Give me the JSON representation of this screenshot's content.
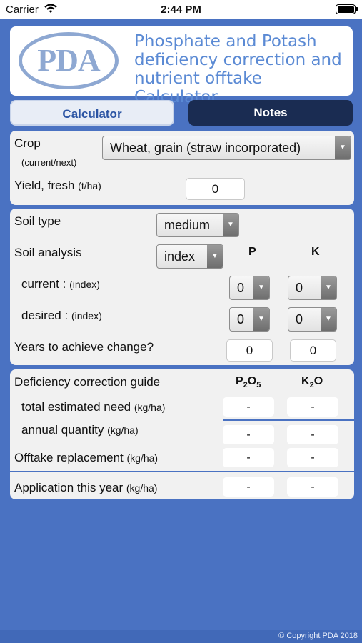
{
  "status_bar": {
    "carrier": "Carrier",
    "time": "2:44 PM"
  },
  "header": {
    "logo_text": "PDA",
    "title": "Phosphate and Potash deficiency correction and nutrient offtake Calculator"
  },
  "tabs": {
    "calculator": "Calculator",
    "notes": "Notes"
  },
  "crop": {
    "label": "Crop",
    "sublabel": "(current/next)",
    "value": "Wheat, grain (straw incorporated)"
  },
  "yield": {
    "label": "Yield, fresh",
    "unit": "(t/ha)",
    "value": "0"
  },
  "soil": {
    "type_label": "Soil type",
    "type_value": "medium",
    "analysis_label": "Soil analysis",
    "analysis_value": "index",
    "col_p": "P",
    "col_k": "K",
    "current_label": "current :",
    "current_unit": "(index)",
    "current_p": "0",
    "current_k": "0",
    "desired_label": "desired :",
    "desired_unit": "(index)",
    "desired_p": "0",
    "desired_k": "0",
    "years_label": "Years to achieve change?",
    "years_p": "0",
    "years_k": "0"
  },
  "results": {
    "guide_label": "Deficiency correction guide",
    "col_p2o5": "P2O5",
    "col_k2o": "K2O",
    "total_label": "total estimated need",
    "total_unit": "(kg/ha)",
    "total_p": "-",
    "total_k": "-",
    "annual_label": "annual quantity",
    "annual_unit": "(kg/ha)",
    "annual_p": "-",
    "annual_k": "-",
    "offtake_label": "Offtake replacement",
    "offtake_unit": "(kg/ha)",
    "offtake_p": "-",
    "offtake_k": "-",
    "application_label": "Application this year",
    "application_unit": "(kg/ha)",
    "application_p": "-",
    "application_k": "-"
  },
  "footer": {
    "copyright": "© Copyright PDA 2018"
  },
  "colors": {
    "background": "#4a72c2",
    "accent": "#2c55a4",
    "notes_tab": "#1a2c52",
    "title": "#5b8ad4"
  }
}
